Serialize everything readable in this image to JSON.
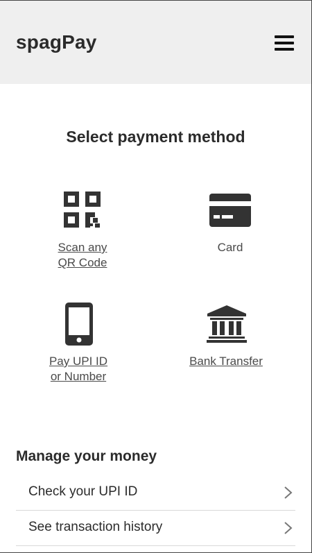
{
  "app": {
    "brand": "spagPay"
  },
  "header": {
    "menu_icon": "hamburger-menu-icon"
  },
  "payment": {
    "title": "Select payment method",
    "options": [
      {
        "line1": "Scan any",
        "line2": "QR Code",
        "icon": "qr-code-icon"
      },
      {
        "line1": "Card",
        "line2": "",
        "icon": "credit-card-icon"
      },
      {
        "line1": "Pay UPI ID",
        "line2": "or Number",
        "icon": "mobile-phone-icon"
      },
      {
        "line1": "Bank Transfer",
        "line2": "",
        "icon": "bank-icon"
      }
    ]
  },
  "manage": {
    "title": "Manage your money",
    "items": [
      {
        "label": "Check your UPI ID",
        "icon": "chevron-right-icon"
      },
      {
        "label": "See transaction history",
        "icon": "chevron-right-icon"
      }
    ]
  },
  "colors": {
    "header_bg": "#efefef",
    "icon": "#333333",
    "text": "#2b2b2b"
  }
}
